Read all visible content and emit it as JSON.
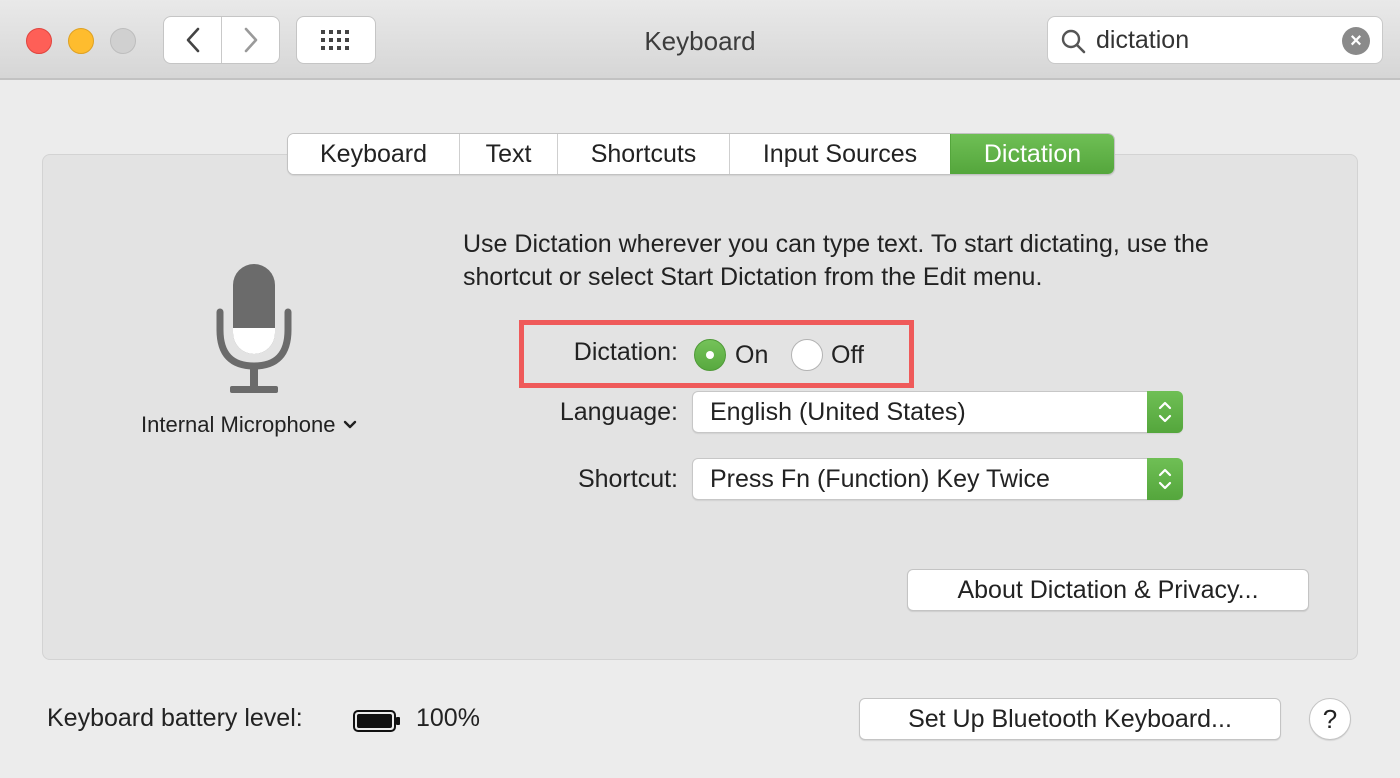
{
  "window": {
    "title": "Keyboard"
  },
  "toolbar": {
    "back_icon": "chevron-left",
    "forward_icon": "chevron-right",
    "show_all_icon": "grid-dots"
  },
  "search": {
    "value": "dictation",
    "icon": "magnifier",
    "clear_label": "×"
  },
  "tabs": [
    {
      "label": "Keyboard",
      "selected": false
    },
    {
      "label": "Text",
      "selected": false
    },
    {
      "label": "Shortcuts",
      "selected": false
    },
    {
      "label": "Input Sources",
      "selected": false
    },
    {
      "label": "Dictation",
      "selected": true
    }
  ],
  "microphone": {
    "icon": "microphone",
    "source_label": "Internal Microphone"
  },
  "dictation": {
    "description": "Use Dictation wherever you can type text. To start dictating, use the shortcut or select Start Dictation from the Edit menu.",
    "toggle_label": "Dictation:",
    "on_label": "On",
    "off_label": "Off",
    "selected": "On",
    "language_label": "Language:",
    "language_value": "English (United States)",
    "shortcut_label": "Shortcut:",
    "shortcut_value": "Press Fn (Function) Key Twice",
    "about_button": "About Dictation & Privacy..."
  },
  "footer": {
    "battery_label": "Keyboard battery level:",
    "battery_icon": "battery-full",
    "battery_value": "100%",
    "bluetooth_button": "Set Up Bluetooth Keyboard...",
    "help_label": "?"
  },
  "colors": {
    "accent": "#5cb043",
    "highlight_box": "#ef5a5a"
  }
}
